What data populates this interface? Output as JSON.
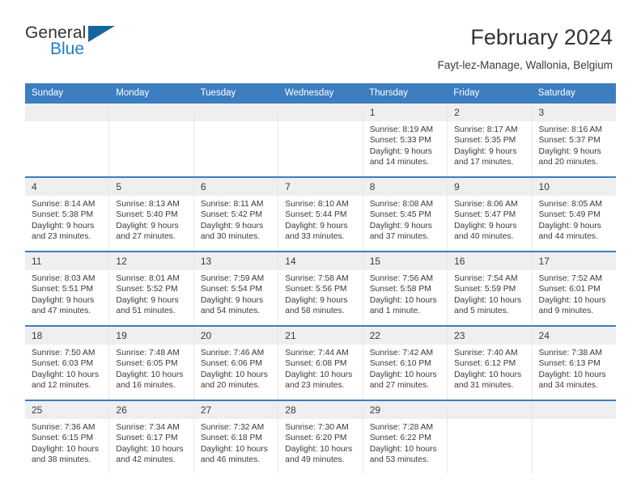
{
  "logo": {
    "line1": "General",
    "line2": "Blue",
    "triangle_color": "#15659f",
    "blue_color": "#1f7fc4"
  },
  "header": {
    "title": "February 2024",
    "subtitle": "Fayt-lez-Manage, Wallonia, Belgium"
  },
  "calendar": {
    "header_color": "#3c7ec0",
    "weekdays": [
      "Sunday",
      "Monday",
      "Tuesday",
      "Wednesday",
      "Thursday",
      "Friday",
      "Saturday"
    ],
    "weeks": [
      [
        {
          "day": "",
          "empty": true
        },
        {
          "day": "",
          "empty": true
        },
        {
          "day": "",
          "empty": true
        },
        {
          "day": "",
          "empty": true
        },
        {
          "day": "1",
          "sunrise": "Sunrise: 8:19 AM",
          "sunset": "Sunset: 5:33 PM",
          "daylight": "Daylight: 9 hours and 14 minutes."
        },
        {
          "day": "2",
          "sunrise": "Sunrise: 8:17 AM",
          "sunset": "Sunset: 5:35 PM",
          "daylight": "Daylight: 9 hours and 17 minutes."
        },
        {
          "day": "3",
          "sunrise": "Sunrise: 8:16 AM",
          "sunset": "Sunset: 5:37 PM",
          "daylight": "Daylight: 9 hours and 20 minutes."
        }
      ],
      [
        {
          "day": "4",
          "sunrise": "Sunrise: 8:14 AM",
          "sunset": "Sunset: 5:38 PM",
          "daylight": "Daylight: 9 hours and 23 minutes."
        },
        {
          "day": "5",
          "sunrise": "Sunrise: 8:13 AM",
          "sunset": "Sunset: 5:40 PM",
          "daylight": "Daylight: 9 hours and 27 minutes."
        },
        {
          "day": "6",
          "sunrise": "Sunrise: 8:11 AM",
          "sunset": "Sunset: 5:42 PM",
          "daylight": "Daylight: 9 hours and 30 minutes."
        },
        {
          "day": "7",
          "sunrise": "Sunrise: 8:10 AM",
          "sunset": "Sunset: 5:44 PM",
          "daylight": "Daylight: 9 hours and 33 minutes."
        },
        {
          "day": "8",
          "sunrise": "Sunrise: 8:08 AM",
          "sunset": "Sunset: 5:45 PM",
          "daylight": "Daylight: 9 hours and 37 minutes."
        },
        {
          "day": "9",
          "sunrise": "Sunrise: 8:06 AM",
          "sunset": "Sunset: 5:47 PM",
          "daylight": "Daylight: 9 hours and 40 minutes."
        },
        {
          "day": "10",
          "sunrise": "Sunrise: 8:05 AM",
          "sunset": "Sunset: 5:49 PM",
          "daylight": "Daylight: 9 hours and 44 minutes."
        }
      ],
      [
        {
          "day": "11",
          "sunrise": "Sunrise: 8:03 AM",
          "sunset": "Sunset: 5:51 PM",
          "daylight": "Daylight: 9 hours and 47 minutes."
        },
        {
          "day": "12",
          "sunrise": "Sunrise: 8:01 AM",
          "sunset": "Sunset: 5:52 PM",
          "daylight": "Daylight: 9 hours and 51 minutes."
        },
        {
          "day": "13",
          "sunrise": "Sunrise: 7:59 AM",
          "sunset": "Sunset: 5:54 PM",
          "daylight": "Daylight: 9 hours and 54 minutes."
        },
        {
          "day": "14",
          "sunrise": "Sunrise: 7:58 AM",
          "sunset": "Sunset: 5:56 PM",
          "daylight": "Daylight: 9 hours and 58 minutes."
        },
        {
          "day": "15",
          "sunrise": "Sunrise: 7:56 AM",
          "sunset": "Sunset: 5:58 PM",
          "daylight": "Daylight: 10 hours and 1 minute."
        },
        {
          "day": "16",
          "sunrise": "Sunrise: 7:54 AM",
          "sunset": "Sunset: 5:59 PM",
          "daylight": "Daylight: 10 hours and 5 minutes."
        },
        {
          "day": "17",
          "sunrise": "Sunrise: 7:52 AM",
          "sunset": "Sunset: 6:01 PM",
          "daylight": "Daylight: 10 hours and 9 minutes."
        }
      ],
      [
        {
          "day": "18",
          "sunrise": "Sunrise: 7:50 AM",
          "sunset": "Sunset: 6:03 PM",
          "daylight": "Daylight: 10 hours and 12 minutes."
        },
        {
          "day": "19",
          "sunrise": "Sunrise: 7:48 AM",
          "sunset": "Sunset: 6:05 PM",
          "daylight": "Daylight: 10 hours and 16 minutes."
        },
        {
          "day": "20",
          "sunrise": "Sunrise: 7:46 AM",
          "sunset": "Sunset: 6:06 PM",
          "daylight": "Daylight: 10 hours and 20 minutes."
        },
        {
          "day": "21",
          "sunrise": "Sunrise: 7:44 AM",
          "sunset": "Sunset: 6:08 PM",
          "daylight": "Daylight: 10 hours and 23 minutes."
        },
        {
          "day": "22",
          "sunrise": "Sunrise: 7:42 AM",
          "sunset": "Sunset: 6:10 PM",
          "daylight": "Daylight: 10 hours and 27 minutes."
        },
        {
          "day": "23",
          "sunrise": "Sunrise: 7:40 AM",
          "sunset": "Sunset: 6:12 PM",
          "daylight": "Daylight: 10 hours and 31 minutes."
        },
        {
          "day": "24",
          "sunrise": "Sunrise: 7:38 AM",
          "sunset": "Sunset: 6:13 PM",
          "daylight": "Daylight: 10 hours and 34 minutes."
        }
      ],
      [
        {
          "day": "25",
          "sunrise": "Sunrise: 7:36 AM",
          "sunset": "Sunset: 6:15 PM",
          "daylight": "Daylight: 10 hours and 38 minutes."
        },
        {
          "day": "26",
          "sunrise": "Sunrise: 7:34 AM",
          "sunset": "Sunset: 6:17 PM",
          "daylight": "Daylight: 10 hours and 42 minutes."
        },
        {
          "day": "27",
          "sunrise": "Sunrise: 7:32 AM",
          "sunset": "Sunset: 6:18 PM",
          "daylight": "Daylight: 10 hours and 46 minutes."
        },
        {
          "day": "28",
          "sunrise": "Sunrise: 7:30 AM",
          "sunset": "Sunset: 6:20 PM",
          "daylight": "Daylight: 10 hours and 49 minutes."
        },
        {
          "day": "29",
          "sunrise": "Sunrise: 7:28 AM",
          "sunset": "Sunset: 6:22 PM",
          "daylight": "Daylight: 10 hours and 53 minutes."
        },
        {
          "day": "",
          "empty": true
        },
        {
          "day": "",
          "empty": true
        }
      ]
    ]
  }
}
